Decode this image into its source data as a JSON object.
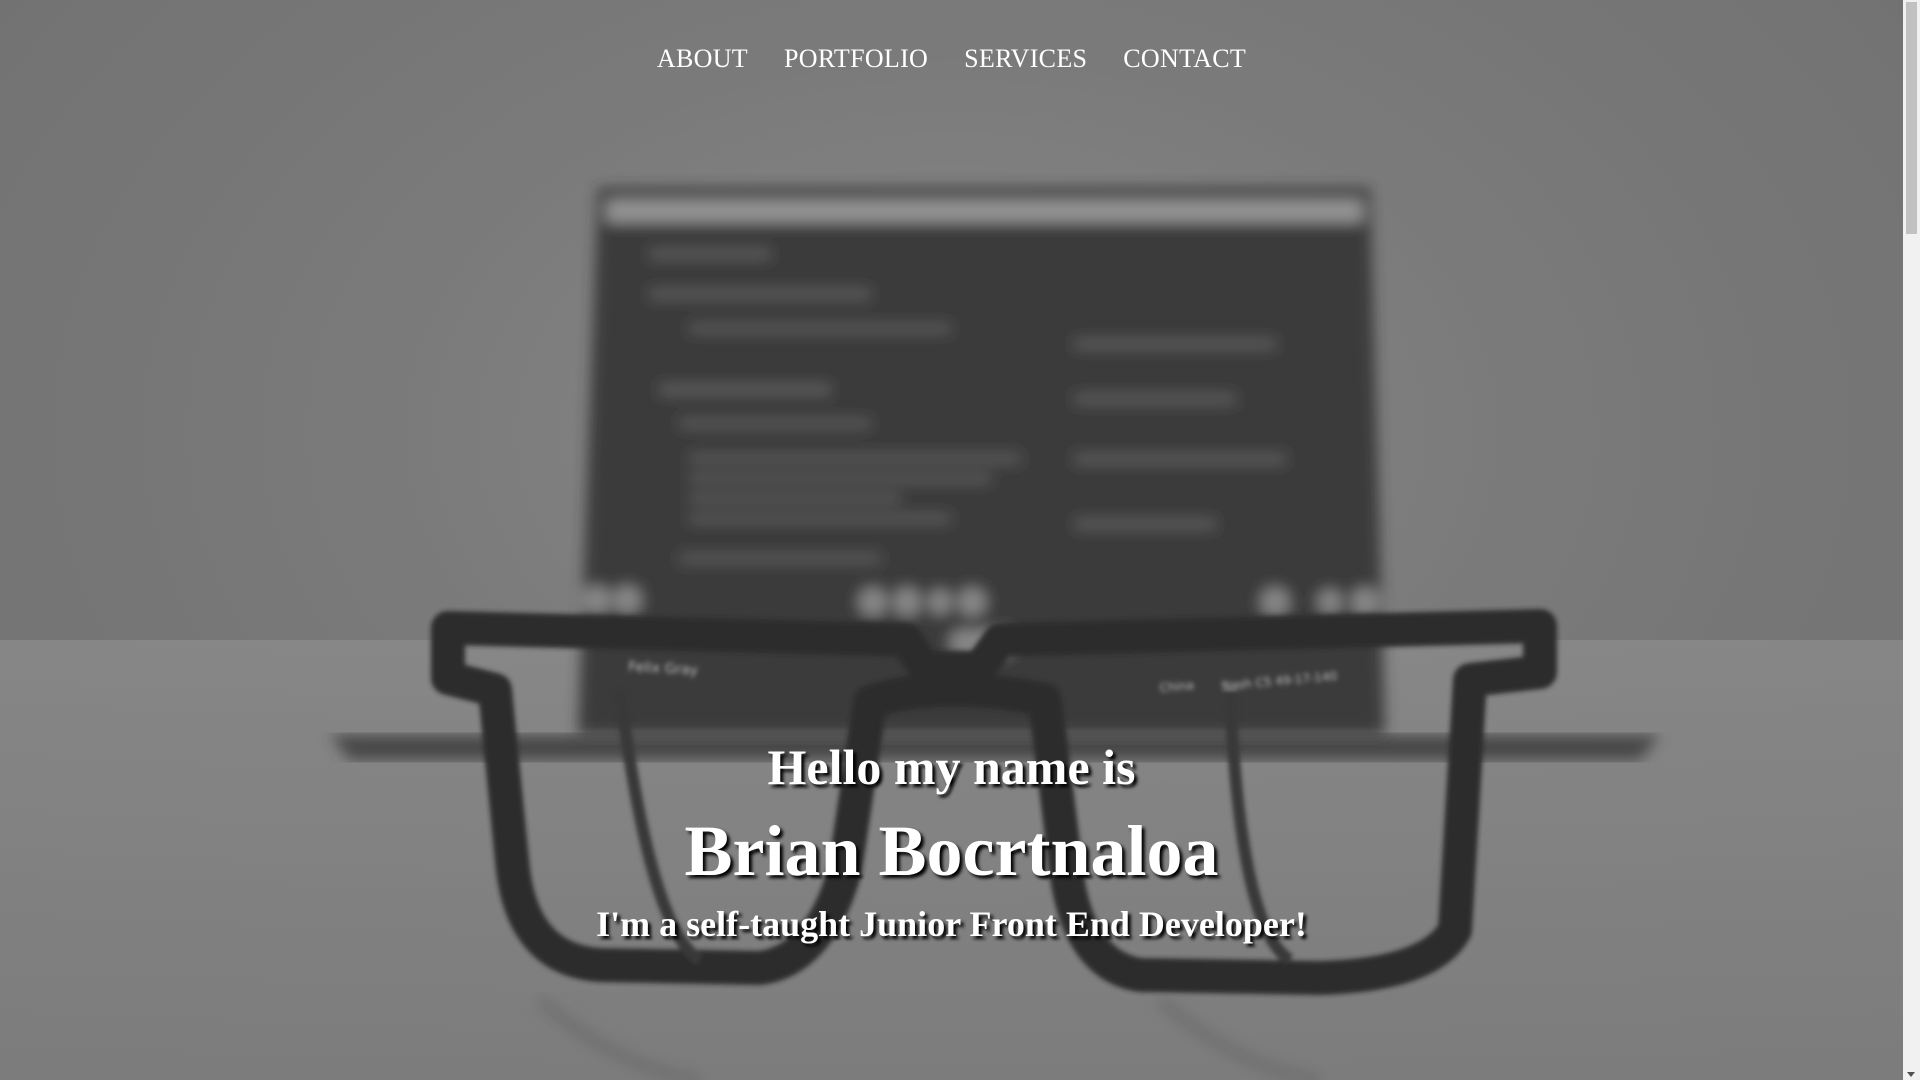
{
  "nav": {
    "items": [
      "ABOUT",
      "PORTFOLIO",
      "SERVICES",
      "CONTACT"
    ]
  },
  "hero": {
    "greeting": "Hello my name is",
    "name": "Brian Bocrtnaloa",
    "tagline": "I'm a self-taught Junior Front End Developer!",
    "background_image": "laptop-with-glasses-photo",
    "glasses_brand_text": "Felix Gray",
    "glasses_arm_text": "China     Nash C5 49-17-140"
  },
  "colors": {
    "text": "#ffffff",
    "overlay": "#7b7b7b",
    "text_shadow": "#000000"
  }
}
